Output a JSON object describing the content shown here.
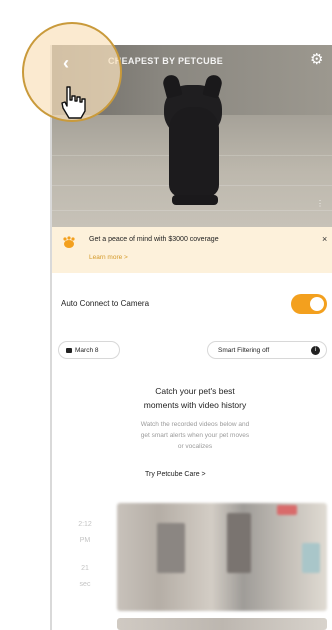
{
  "camera": {
    "title": "CHEAPEST BY PETCUBE",
    "icons": [
      "back-icon",
      "gear-icon",
      "dots-icon"
    ]
  },
  "banner": {
    "text": "Get a peace of mind with $3000 coverage",
    "link": "Learn more >",
    "close": "×",
    "icon": "paw-icon"
  },
  "auto_connect": {
    "label": "Auto Connect to Camera",
    "enabled": true
  },
  "filters": {
    "date_label": "March 8",
    "smart_filter_label": "Smart Filtering off"
  },
  "promo": {
    "title_line1": "Catch your pet's best",
    "title_line2": "moments with video history",
    "desc_line1": "Watch the recorded videos below and",
    "desc_line2": "get smart alerts when your pet moves",
    "desc_line3": "or vocalizes",
    "link": "Try Petcube Care >"
  },
  "timeline": {
    "times": [
      "2:12",
      "PM",
      "21",
      "sec"
    ]
  },
  "colors": {
    "accent": "#f3a01e",
    "banner_bg": "#fdf1db",
    "highlight": "#c99a3b"
  }
}
